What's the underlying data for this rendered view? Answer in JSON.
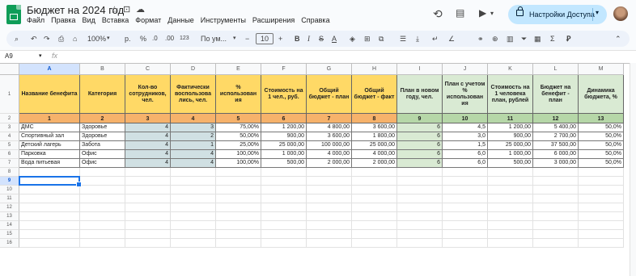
{
  "app": {
    "doc_title": "Бюджет на 2024 год",
    "menu": [
      "Файл",
      "Правка",
      "Вид",
      "Вставка",
      "Формат",
      "Данные",
      "Инструменты",
      "Расширения",
      "Справка"
    ],
    "share_label": "Настройки Доступа"
  },
  "toolbar": {
    "zoom": "100%",
    "currency": "р.",
    "percent": "%",
    "dec_less": ".0",
    "dec_more": ".00",
    "number_format": "123",
    "font": "По ум...",
    "font_size": "10",
    "bold": "B",
    "italic": "I"
  },
  "formula_bar": {
    "name_box": "A9",
    "fx": "fx"
  },
  "columns": [
    "A",
    "B",
    "C",
    "D",
    "E",
    "F",
    "G",
    "H",
    "I",
    "J",
    "K",
    "L",
    "M"
  ],
  "rows": [
    "1",
    "2",
    "3",
    "4",
    "5",
    "6",
    "7",
    "8",
    "9",
    "10",
    "11",
    "12",
    "13",
    "14",
    "15",
    "16"
  ],
  "selected": {
    "column": "A",
    "row": "9"
  },
  "header_row": [
    "Название бенефита",
    "Категория",
    "Кол-во сотрудников, чел.",
    "Фактически воспользова лись, чел.",
    "% использован ия",
    "Стоимость на 1 чел., руб.",
    "Общий бюджет - план",
    "Общий бюджет - факт",
    "План в новом году, чел.",
    "План с учетом % использован ия",
    "Стоимость на 1 человека план, рублей",
    "Бюджет на бенефит - план",
    "Динамика бюджета, %"
  ],
  "number_row": [
    "1",
    "2",
    "3",
    "4",
    "5",
    "6",
    "7",
    "8",
    "9",
    "10",
    "11",
    "12",
    "13"
  ],
  "data_rows": [
    [
      "ДМС",
      "Здоровье",
      "4",
      "3",
      "75,00%",
      "1 200,00",
      "4 800,00",
      "3 600,00",
      "6",
      "4,5",
      "1 200,00",
      "5 400,00",
      "50,0%"
    ],
    [
      "Спортивный зал",
      "Здоровье",
      "4",
      "2",
      "50,00%",
      "900,00",
      "3 600,00",
      "1 800,00",
      "6",
      "3,0",
      "900,00",
      "2 700,00",
      "50,0%"
    ],
    [
      "Детский лагерь",
      "Забота",
      "4",
      "1",
      "25,00%",
      "25 000,00",
      "100 000,00",
      "25 000,00",
      "6",
      "1,5",
      "25 000,00",
      "37 500,00",
      "50,0%"
    ],
    [
      "Парковка",
      "Офис",
      "4",
      "4",
      "100,00%",
      "1 000,00",
      "4 000,00",
      "4 000,00",
      "6",
      "6,0",
      "1 000,00",
      "6 000,00",
      "50,0%"
    ],
    [
      "Вода питьевая",
      "Офис",
      "4",
      "4",
      "100,00%",
      "500,00",
      "2 000,00",
      "2 000,00",
      "6",
      "6,0",
      "500,00",
      "3 000,00",
      "50,0%"
    ]
  ],
  "colors": {
    "header_yellow": "#ffd966",
    "header_green": "#d9ead3",
    "number_row_orange": "#f6b26b",
    "number_row_green": "#b6d7a8",
    "input_blue": "#d0e0e3",
    "input_green": "#d9ead3"
  }
}
